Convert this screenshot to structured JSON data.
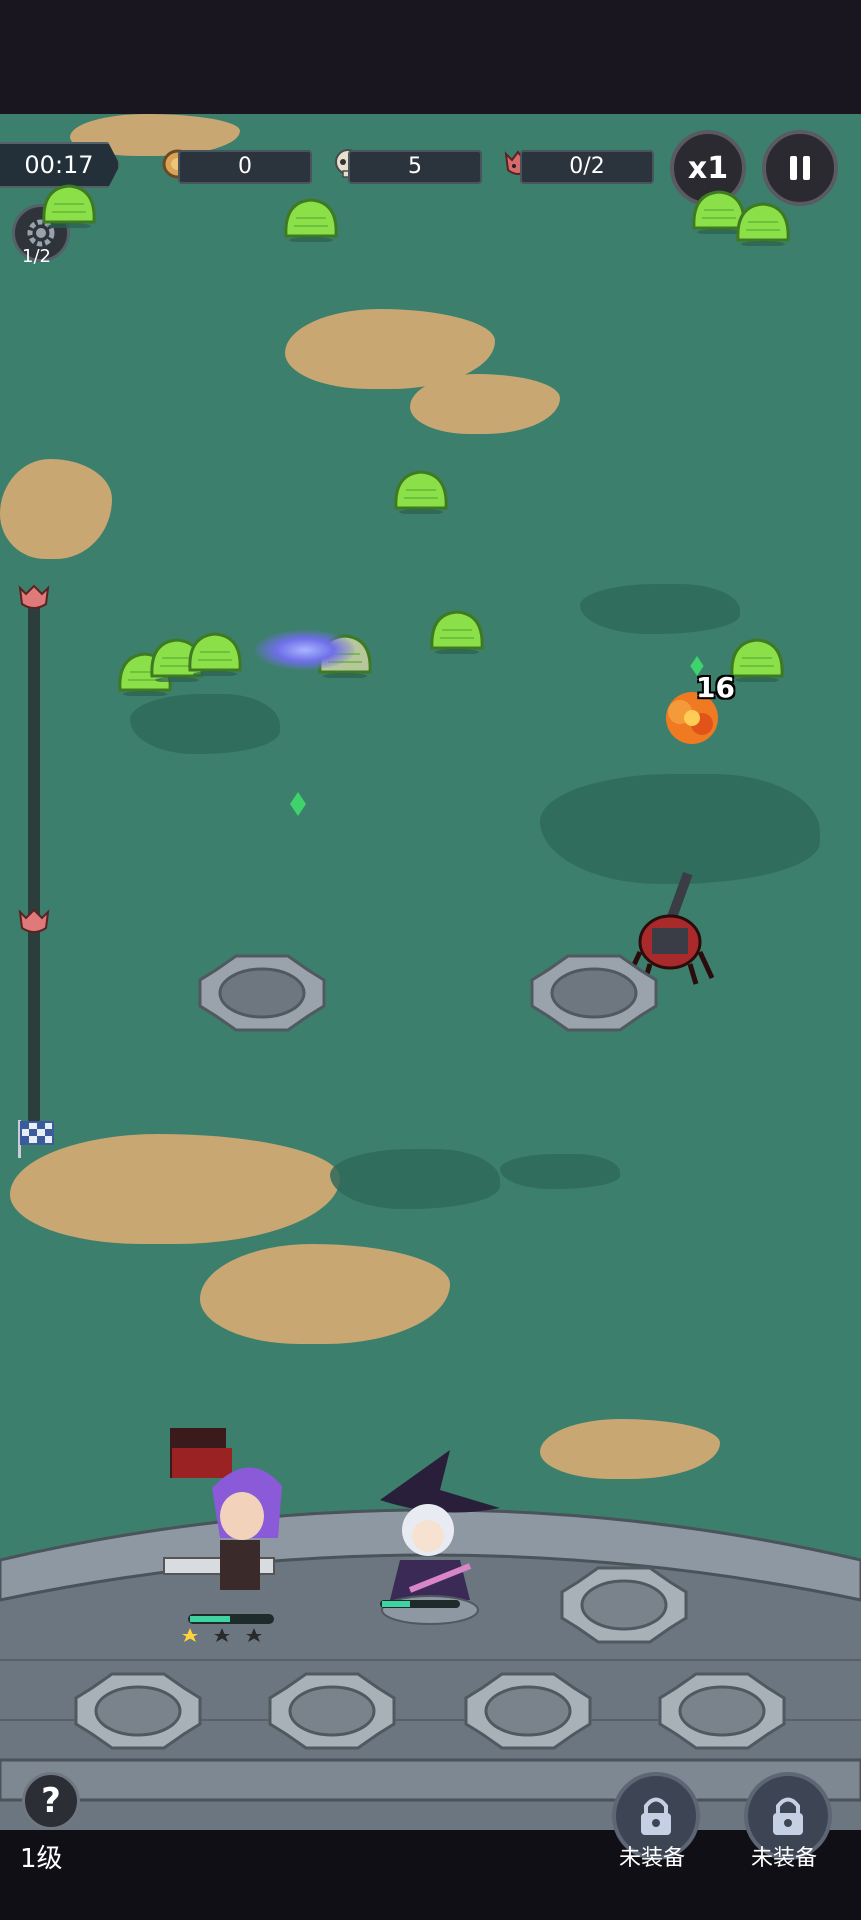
{
  "hud": {
    "timer": "00:17",
    "coins": "0",
    "kills": "5",
    "boss_progress": "0/2",
    "speed_label": "x1",
    "gear_count": "1/2"
  },
  "battle": {
    "damage_number": "16"
  },
  "bottom": {
    "level": "1级",
    "slot1_label": "未装备",
    "slot2_label": "未装备"
  },
  "colors": {
    "grass": "#3d7f6d",
    "dirt": "#c9a773",
    "slime": "#8be04a",
    "wall": "#6c7680"
  },
  "icons": {
    "coin": "coin-icon",
    "kills": "skull-icon",
    "boss": "demon-icon",
    "pause": "pause-icon",
    "gear": "gear-icon",
    "help": "question-icon",
    "lock": "lock-icon",
    "flag": "checkered-flag-icon"
  }
}
